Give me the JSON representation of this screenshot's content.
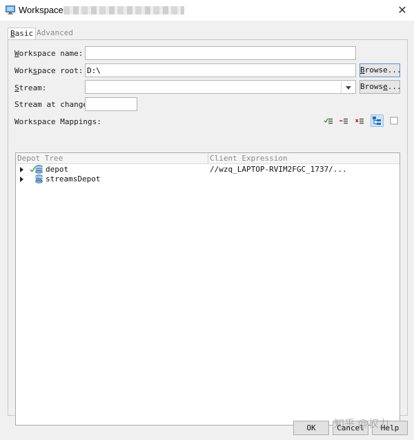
{
  "window": {
    "title": "Workspace:",
    "icon": "monitor-icon"
  },
  "tabs": [
    {
      "label_first": "B",
      "label_rest": "asic",
      "active": true
    },
    {
      "label": "Advanced",
      "active": false
    }
  ],
  "form": {
    "workspace_name": {
      "label_first": "W",
      "label_rest": "orkspace name:",
      "value": ""
    },
    "workspace_root": {
      "label_pre": "Work",
      "label_key": "s",
      "label_post": "pace root:",
      "value": "D:\\",
      "browse_first": "B",
      "browse_rest": "rowse..."
    },
    "stream": {
      "label_first": "S",
      "label_rest": "tream:",
      "value": "",
      "browse_pre": "Brows",
      "browse_key": "e",
      "browse_post": "..."
    },
    "stream_at_change": {
      "label": "Stream at change:",
      "value": ""
    }
  },
  "mappings": {
    "label": "Workspace Mappings:",
    "toolbar": [
      "include-mapping-icon",
      "exclude-mapping-icon",
      "remove-mapping-icon",
      "tree-view-icon",
      "text-view-icon"
    ],
    "columns": [
      "Depot Tree",
      "Client Expression"
    ],
    "rows": [
      {
        "name": "depot",
        "icon": "depot-icon",
        "checked": true,
        "client_expression": "//wzq_LAPTOP-RVIM2FGC_1737/..."
      },
      {
        "name": "streamsDepot",
        "icon": "streams-depot-icon",
        "checked": false,
        "client_expression": ""
      }
    ]
  },
  "buttons": {
    "ok": "OK",
    "cancel": "Cancel",
    "help": "Help"
  },
  "watermark": "知乎 @权力"
}
